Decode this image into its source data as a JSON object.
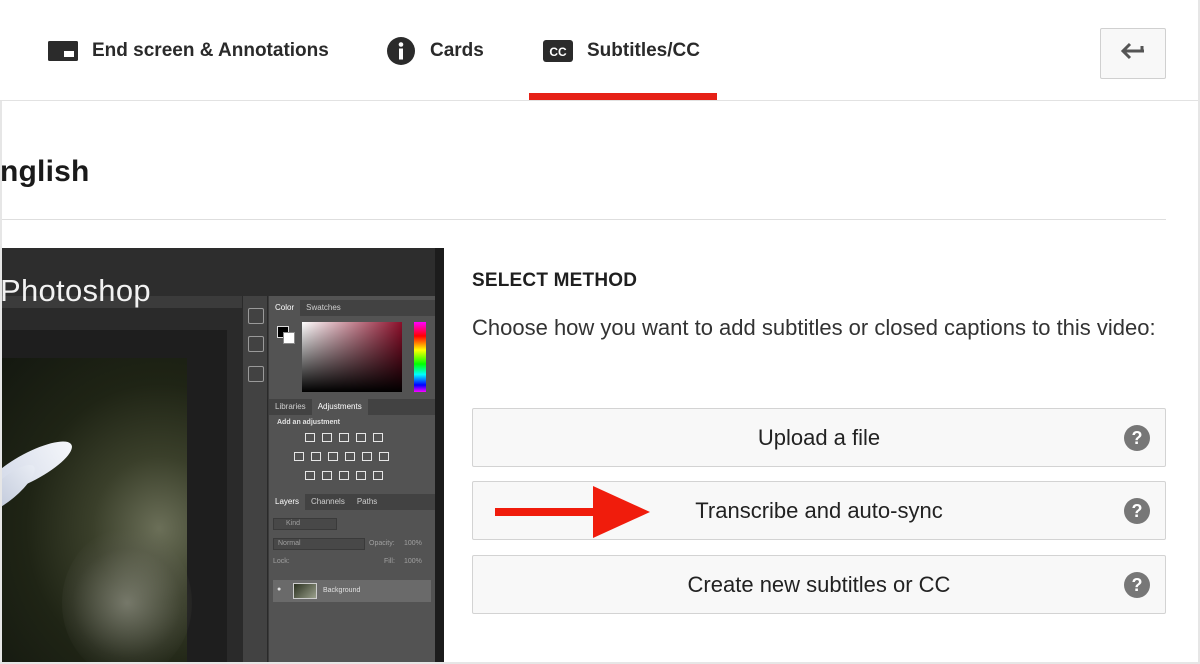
{
  "tabs": [
    {
      "label": "End screen & Annotations",
      "icon": "end-screen-icon",
      "active": false
    },
    {
      "label": "Cards",
      "icon": "info-icon",
      "active": false
    },
    {
      "label": "Subtitles/CC",
      "icon": "cc-icon",
      "active": true
    }
  ],
  "accent_color": "#e62117",
  "back_button": {
    "icon": "back-arrow-icon"
  },
  "language_title": "nglish",
  "video": {
    "title": "Photoshop",
    "panels": {
      "color_tabs": [
        "Color",
        "Swatches"
      ],
      "adjust_tabs": [
        "Libraries",
        "Adjustments"
      ],
      "add_adjustment": "Add an adjustment",
      "layers_tabs": [
        "Layers",
        "Channels",
        "Paths"
      ],
      "kind": "Kind",
      "blend_mode": "Normal",
      "opacity_label": "Opacity:",
      "opacity_value": "100%",
      "lock_label": "Lock:",
      "fill_label": "Fill:",
      "fill_value": "100%",
      "layer_name": "Background"
    }
  },
  "select_method": {
    "heading": "SELECT METHOD",
    "description": "Choose how you want to add subtitles or closed captions to this video:",
    "options": [
      {
        "label": "Upload a file",
        "help": "?"
      },
      {
        "label": "Transcribe and auto-sync",
        "help": "?"
      },
      {
        "label": "Create new subtitles or CC",
        "help": "?"
      }
    ]
  },
  "annotation_arrow_color": "#f01c0c"
}
